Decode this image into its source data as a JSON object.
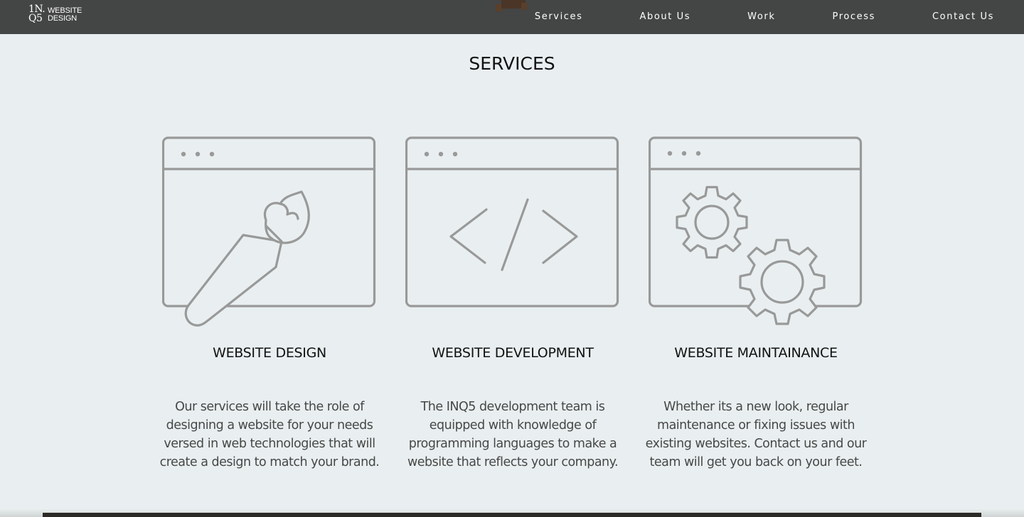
{
  "brand": {
    "mark_line1": "1N.",
    "mark_line2": "Q5",
    "text_line1": "WEBSITE",
    "text_line2": "DESIGN"
  },
  "nav": {
    "items": [
      {
        "label": "Services"
      },
      {
        "label": "About Us"
      },
      {
        "label": "Work"
      },
      {
        "label": "Process"
      },
      {
        "label": "Contact Us"
      }
    ]
  },
  "colors": {
    "navbar": "#444545",
    "background": "#e9eff0",
    "icon_stroke": "#999999",
    "title_text": "#111111",
    "body_text": "#474747"
  },
  "services": {
    "title": "SERVICES",
    "cards": [
      {
        "icon": "browser-paintbrush-icon",
        "title": "WEBSITE DESIGN",
        "description": "Our services will take the role of designing a website for your needs versed in web technologies that will create a design to match your brand."
      },
      {
        "icon": "browser-code-icon",
        "title": "WEBSITE DEVELOPMENT",
        "description": "The INQ5 development team is equipped with knowledge of programming languages to make a website that reflects your company."
      },
      {
        "icon": "browser-gears-icon",
        "title": "WEBSITE MAINTAINANCE",
        "description": "Whether its a new look, regular maintenance or fixing issues with existing websites. Contact us and our team will get you back on your feet."
      }
    ]
  }
}
